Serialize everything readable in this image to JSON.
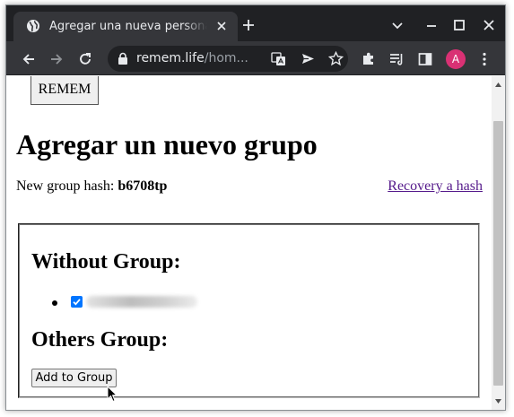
{
  "browser": {
    "tab": {
      "title": "Agregar una nueva persona",
      "favicon": "globe-icon",
      "close": "close-icon"
    },
    "new_tab": "plus-icon",
    "window_controls": [
      "chevron-down-icon",
      "minimize-icon",
      "maximize-icon",
      "close-icon"
    ],
    "nav": [
      "back-arrow-icon",
      "forward-arrow-icon",
      "reload-icon"
    ],
    "address": {
      "lock": "lock-icon",
      "host": "remem.life",
      "path": "/hom..."
    },
    "omnibox_actions": [
      "translate-icon",
      "send-icon",
      "star-icon"
    ],
    "toolbar_actions": [
      "puzzle-icon",
      "reading-list-icon",
      "side-panel-icon",
      "kebab-menu-icon"
    ],
    "profile_initial": "A",
    "colors": {
      "frame": "#202124",
      "toolbar": "#35363a",
      "avatar": "#d93174",
      "link": "#551a8b",
      "checkbox": "#0075ff"
    }
  },
  "page": {
    "app_button": "REMEM",
    "title": "Agregar un nuevo grupo",
    "hash_label": "New group hash: ",
    "hash_value": "b6708tp",
    "recovery_link": "Recovery a hash",
    "sections": {
      "without_group": "Without Group:",
      "others_group": "Others Group:"
    },
    "contacts": [
      {
        "checked": true
      }
    ],
    "add_button": "Add to Group"
  }
}
